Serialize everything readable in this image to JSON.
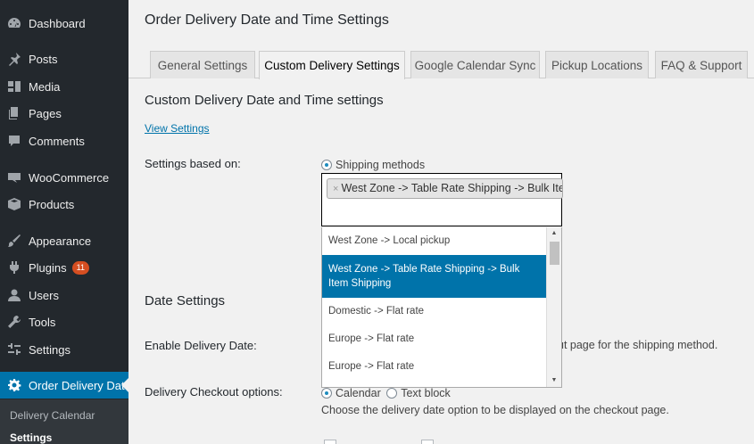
{
  "sidebar": {
    "items": [
      {
        "label": "Dashboard",
        "icon": "dashboard-icon"
      },
      {
        "label": "Posts",
        "icon": "pin-icon"
      },
      {
        "label": "Media",
        "icon": "media-icon"
      },
      {
        "label": "Pages",
        "icon": "pages-icon"
      },
      {
        "label": "Comments",
        "icon": "comment-icon"
      },
      {
        "label": "WooCommerce",
        "icon": "woocommerce-icon"
      },
      {
        "label": "Products",
        "icon": "box-icon"
      },
      {
        "label": "Appearance",
        "icon": "brush-icon"
      },
      {
        "label": "Plugins",
        "icon": "plug-icon",
        "badge": "11"
      },
      {
        "label": "Users",
        "icon": "user-icon"
      },
      {
        "label": "Tools",
        "icon": "wrench-icon"
      },
      {
        "label": "Settings",
        "icon": "sliders-icon"
      },
      {
        "label": "Order Delivery Date",
        "icon": "gear-icon"
      }
    ],
    "submenu": [
      "Delivery Calendar",
      "Settings"
    ]
  },
  "page": {
    "title": "Order Delivery Date and Time Settings",
    "tabs": [
      "General Settings",
      "Custom Delivery Settings",
      "Google Calendar Sync",
      "Pickup Locations",
      "FAQ & Support"
    ],
    "active_tab": "Custom Delivery Settings",
    "section_title": "Custom Delivery Date and Time settings",
    "view_settings_link": "View Settings",
    "settings_based_on_label": "Settings based on:",
    "shipping_methods_radio": "Shipping methods",
    "selected_chip": "West Zone -> Table Rate Shipping -> Bulk Item Shipping",
    "chip_remove": "×",
    "dropdown_options": [
      "West Zone -> Local pickup",
      "West Zone -> Table Rate Shipping -> Bulk Item Shipping",
      "Domestic -> Flat rate",
      "Europe -> Flat rate",
      "Europe -> Flat rate"
    ],
    "date_settings_title": "Date Settings",
    "enable_delivery_date_label": "Enable Delivery Date:",
    "enable_delivery_date_desc": "ut page for the shipping method.",
    "delivery_checkout_label": "Delivery Checkout options:",
    "calendar_radio": "Calendar",
    "text_block_radio": "Text block",
    "delivery_checkout_desc": "Choose the delivery date option to be displayed on the checkout page."
  },
  "colors": {
    "sidebar_bg": "#23282d",
    "accent": "#0073aa",
    "badge": "#d54e21",
    "page_bg": "#f1f1f1"
  }
}
